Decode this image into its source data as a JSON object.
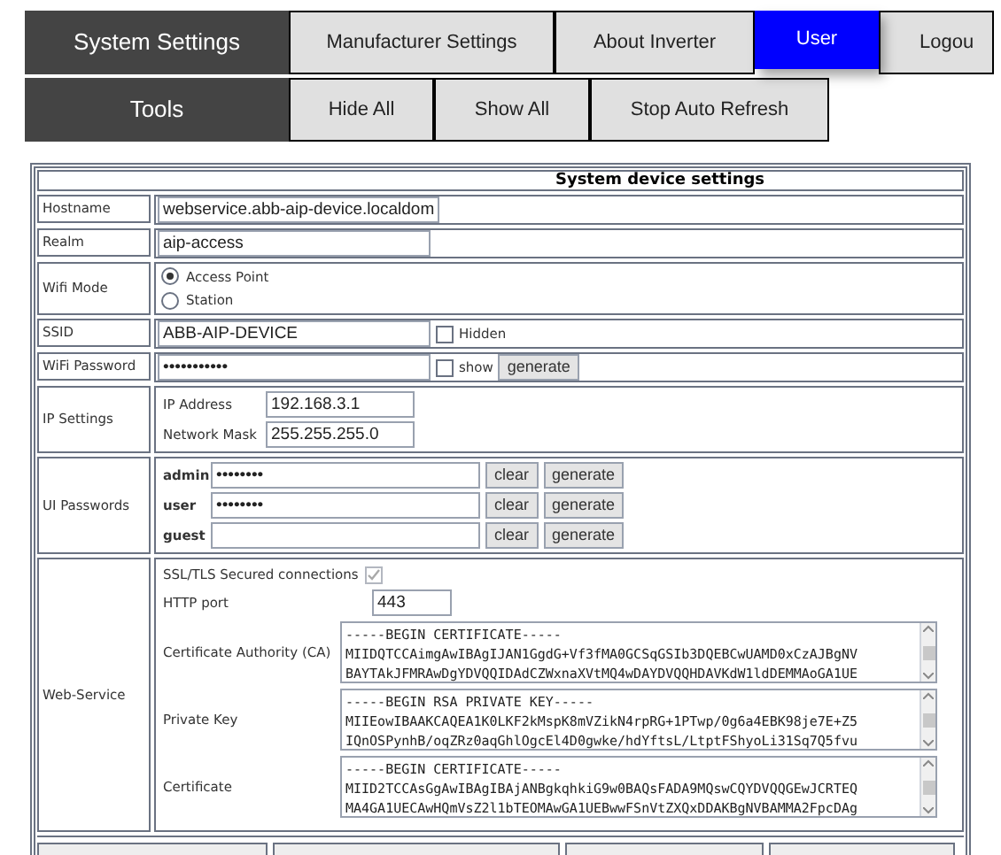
{
  "nav": {
    "rows": [
      {
        "title": "System Settings",
        "buttons": [
          {
            "label": "Manufacturer Settings",
            "selected": false
          },
          {
            "label": "About Inverter",
            "selected": false
          },
          {
            "label": "User",
            "selected": true
          },
          {
            "label": "Logou",
            "selected": false
          }
        ]
      },
      {
        "title": "Tools",
        "buttons": [
          {
            "label": "Hide All"
          },
          {
            "label": "Show All"
          },
          {
            "label": "Stop Auto Refresh"
          }
        ]
      }
    ]
  },
  "settings": {
    "title": "System device settings",
    "rows": [
      {
        "kind": "text",
        "label": "Hostname",
        "value": "webservice.abb-aip-device.localdom"
      },
      {
        "kind": "text",
        "label": "Realm",
        "value": "aip-access"
      },
      {
        "kind": "radio",
        "label": "Wifi Mode",
        "options": [
          {
            "label": "Access Point",
            "selected": true
          },
          {
            "label": "Station",
            "selected": false
          }
        ]
      },
      {
        "kind": "text",
        "label": "SSID",
        "value": "ABB-AIP-DEVICE",
        "checkbox": {
          "label": "Hidden",
          "checked": false
        }
      },
      {
        "kind": "text",
        "label": "WiFi Password",
        "value": "•••••••••••",
        "checkbox": {
          "label": "show",
          "checked": false
        },
        "button": "generate"
      },
      {
        "kind": "fields",
        "label": "IP Settings",
        "fields": [
          {
            "label": "IP Address",
            "value": "192.168.3.1"
          },
          {
            "label": "Network Mask",
            "value": "255.255.255.0"
          }
        ]
      },
      {
        "kind": "passwords",
        "label": "UI Passwords",
        "users": [
          {
            "label": "admin",
            "value": "••••••••",
            "buttons": [
              "clear",
              "generate"
            ]
          },
          {
            "label": "user",
            "value": "••••••••",
            "buttons": [
              "clear",
              "generate"
            ]
          },
          {
            "label": "guest",
            "buttons": [
              "clear",
              "generate"
            ]
          }
        ]
      },
      {
        "kind": "webservice",
        "label": "Web-Service",
        "ssl": {
          "label": "SSL/TLS Secured connections",
          "checked": true,
          "disabled": true
        },
        "port": {
          "label": "HTTP port",
          "value": "443"
        },
        "certs": [
          {
            "label": "Certificate Authority (CA)",
            "lines": [
              "-----BEGIN CERTIFICATE-----",
              "MIIDQTCCAimgAwIBAgIJAN1GgdG+Vf3fMA0GCSqGSIb3DQEBCwUAMD0xCzAJBgNV",
              "BAYTAkJFMRAwDgYDVQQIDAdCZWxnaXVtMQ4wDAYDVQQHDAVKdW1ldDEMMAoGA1UE"
            ]
          },
          {
            "label": "Private Key",
            "lines": [
              "-----BEGIN RSA PRIVATE KEY-----",
              "MIIEowIBAAKCAQEA1K0LKF2kMspK8mVZikN4rpRG+1PTwp/0g6a4EBK98je7E+Z5",
              "IQnOSPynhB/oqZRz0aqGhlOgcEl4D0gwke/hdYftsL/LtptFShyoLi31Sq7Q5fvu"
            ]
          },
          {
            "label": "Certificate",
            "lines": [
              "-----BEGIN CERTIFICATE-----",
              "MIID2TCCAsGgAwIBAgIBAjANBgkqhkiG9w0BAQsFADA9MQswCQYDVQQGEwJCRTEQ",
              "MA4GA1UECAwHQmVsZ2l1bTEOMAwGA1UEBwwFSnVtZXQxDDAKBgNVBAMMA2FpcDAg"
            ]
          }
        ]
      }
    ]
  }
}
